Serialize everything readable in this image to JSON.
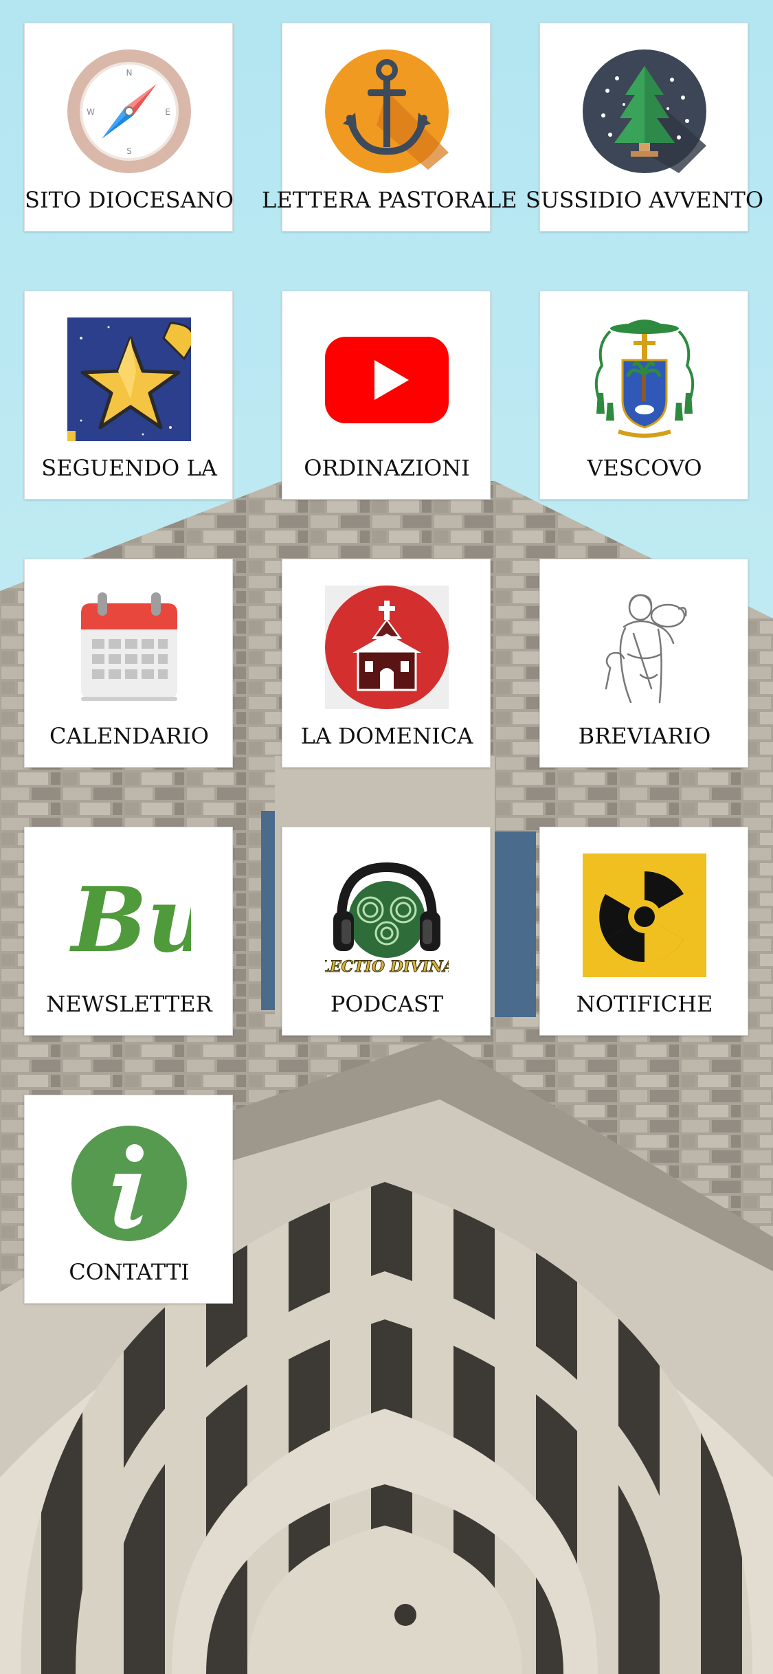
{
  "tiles": [
    {
      "label": "SITO DIOCESANO",
      "icon": "compass-icon"
    },
    {
      "label": "LETTERA PASTORALE",
      "icon": "anchor-icon"
    },
    {
      "label": "SUSSIDIO AVVENTO",
      "icon": "christmas-tree-icon"
    },
    {
      "label": "SEGUENDO LA",
      "icon": "star-icon"
    },
    {
      "label": "ORDINAZIONI",
      "icon": "youtube-play-icon"
    },
    {
      "label": "VESCOVO",
      "icon": "bishop-coat-of-arms-icon"
    },
    {
      "label": "CALENDARIO",
      "icon": "calendar-icon"
    },
    {
      "label": "LA DOMENICA",
      "icon": "church-icon"
    },
    {
      "label": "BREVIARIO",
      "icon": "good-shepherd-icon"
    },
    {
      "label": "NEWSLETTER",
      "icon": "newsletter-logo-icon"
    },
    {
      "label": "PODCAST",
      "icon": "headphones-icon",
      "icon_text": "LECTIO DIVINA"
    },
    {
      "label": "NOTIFICHE",
      "icon": "radiation-icon"
    },
    {
      "label": "CONTATTI",
      "icon": "info-icon"
    }
  ],
  "newsletter_logo_text": "Bu",
  "colors": {
    "sky": "#bfe8f2",
    "stone": "#b9b4aa",
    "anchor_bg": "#f19a22",
    "youtube_red": "#ff0000",
    "church_red": "#d32f2f",
    "radiation_yellow": "#f0c020",
    "info_green": "#559a4e",
    "newsletter_green": "#4f9a3a"
  }
}
